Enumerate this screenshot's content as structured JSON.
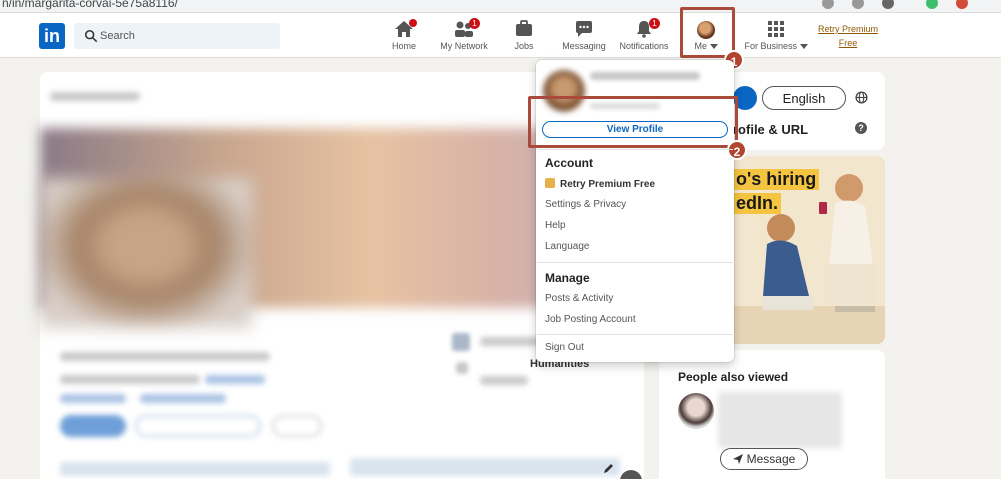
{
  "browser": {
    "url": "n/in/margarita-corvai-5e75a8116/"
  },
  "header": {
    "logo": "in",
    "search_placeholder": "Search",
    "nav": [
      {
        "label": "Home",
        "icon": "home-icon",
        "badge": ""
      },
      {
        "label": "My Network",
        "icon": "network-icon",
        "badge": "1"
      },
      {
        "label": "Jobs",
        "icon": "briefcase-icon",
        "badge": ""
      },
      {
        "label": "Messaging",
        "icon": "messaging-icon",
        "badge": ""
      },
      {
        "label": "Notifications",
        "icon": "bell-icon",
        "badge": "1"
      },
      {
        "label": "Me",
        "icon": "avatar"
      },
      {
        "label": "For Business",
        "icon": "grid-icon"
      }
    ],
    "premium_line1": "Retry Premium",
    "premium_line2": "Free"
  },
  "markers": {
    "step1": "1",
    "step2": "2"
  },
  "dropdown": {
    "view_profile": "View Profile",
    "account_heading": "Account",
    "account_items": [
      "Retry Premium Free",
      "Settings & Privacy",
      "Help",
      "Language"
    ],
    "manage_heading": "Manage",
    "manage_items": [
      "Posts & Activity",
      "Job Posting Account"
    ],
    "sign_out": "Sign Out"
  },
  "profile": {
    "side_text": "Humanities"
  },
  "right": {
    "language_button": "English",
    "profile_url_label": "rofile & URL",
    "help_glyph": "?",
    "ad_line1": "o's hiring",
    "ad_line2": "edIn.",
    "people_also_viewed": "People also viewed",
    "message_button": "Message"
  },
  "colors": {
    "linkedin_blue": "#0a66c2",
    "highlight_red": "#a94a3a",
    "badge_red": "#cc1016",
    "premium_gold": "#915907"
  }
}
